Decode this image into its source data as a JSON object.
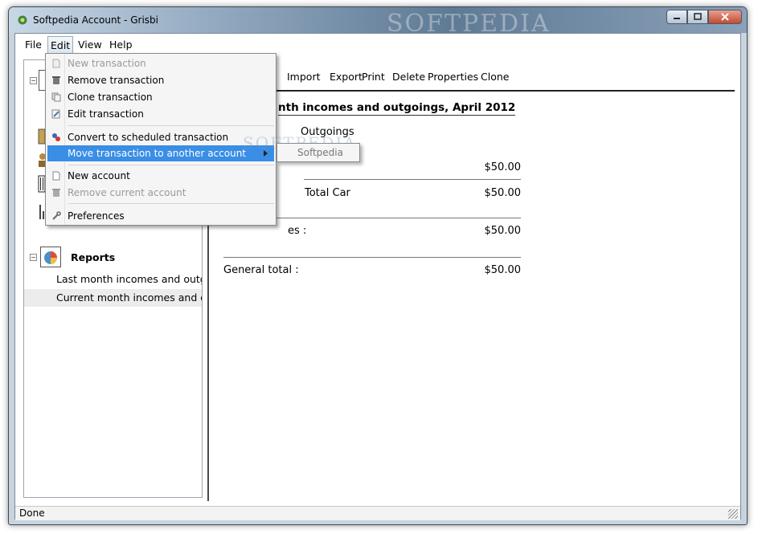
{
  "window": {
    "title": "Softpedia Account - Grisbi",
    "watermark": "SOFTPEDIA"
  },
  "menubar": {
    "file": "File",
    "edit": "Edit",
    "view": "View",
    "help": "Help"
  },
  "toolbar": {
    "import": "Import",
    "export": "Export",
    "print": "Print",
    "delete": "Delete",
    "properties": "Properties",
    "clone": "Clone"
  },
  "sidebar": {
    "reports_label": "Reports",
    "reports": [
      "Last month incomes and outgoings",
      "Current month incomes and outgoings"
    ]
  },
  "report": {
    "title": "nth incomes and outgoings, April 2012",
    "outgoings_label": "Outgoings",
    "row_amount": "$50.00",
    "total_car_label": "Total Car",
    "total_car_amount": "$50.00",
    "total_outgoings_label": "es :",
    "total_outgoings_amount": "$50.00",
    "general_total_label": "General total :",
    "general_total_amount": "$50.00"
  },
  "edit_menu": {
    "new_transaction": "New transaction",
    "remove_transaction": "Remove transaction",
    "clone_transaction": "Clone transaction",
    "edit_transaction": "Edit transaction",
    "convert_scheduled": "Convert to scheduled transaction",
    "move_transaction": "Move transaction to another account",
    "new_account": "New account",
    "remove_account": "Remove current account",
    "preferences": "Preferences"
  },
  "submenu": {
    "account": "Softpedia"
  },
  "status": {
    "text": "Done"
  }
}
